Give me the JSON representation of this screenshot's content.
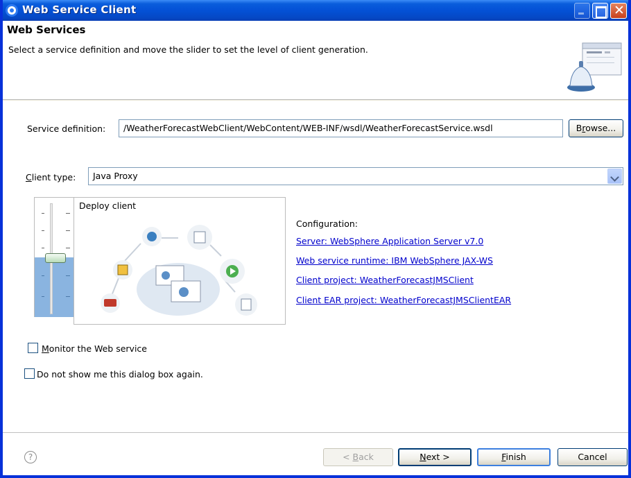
{
  "window": {
    "title": "Web Service Client"
  },
  "banner": {
    "title": "Web Services",
    "description": "Select a service definition and move the slider to set the level of client generation."
  },
  "service_definition": {
    "label": "Service definition:",
    "value": "/WeatherForecastWebClient/WebContent/WEB-INF/wsdl/WeatherForecastService.wsdl",
    "browse_label_pre": "B",
    "browse_label_mnemonic": "r",
    "browse_label_post": "owse..."
  },
  "client_type": {
    "label_mnemonic": "C",
    "label_rest": "lient type:",
    "value": "Java Proxy"
  },
  "slider": {
    "panel_label": "Deploy client",
    "level_fraction": 0.5
  },
  "configuration": {
    "title": "Configuration:",
    "links": [
      "Server: WebSphere Application Server v7.0",
      "Web service runtime: IBM WebSphere JAX-WS",
      "Client project: WeatherForecastJMSClient",
      "Client EAR project: WeatherForecastJMSClientEAR"
    ]
  },
  "checkboxes": {
    "monitor_mnemonic": "M",
    "monitor_rest": "onitor the Web service",
    "monitor_checked": false,
    "dont_show": "Do not show me this dialog box again.",
    "dont_show_checked": false
  },
  "footer": {
    "help_glyph": "?",
    "back_pre": "< ",
    "back_mnemonic": "B",
    "back_post": "ack",
    "next_mnemonic": "N",
    "next_post": "ext >",
    "finish_mnemonic": "F",
    "finish_post": "inish",
    "cancel": "Cancel"
  },
  "colors": {
    "titlebar": "#0451d6",
    "link": "#0000cc",
    "slider_fill": "#8ab4e0"
  }
}
